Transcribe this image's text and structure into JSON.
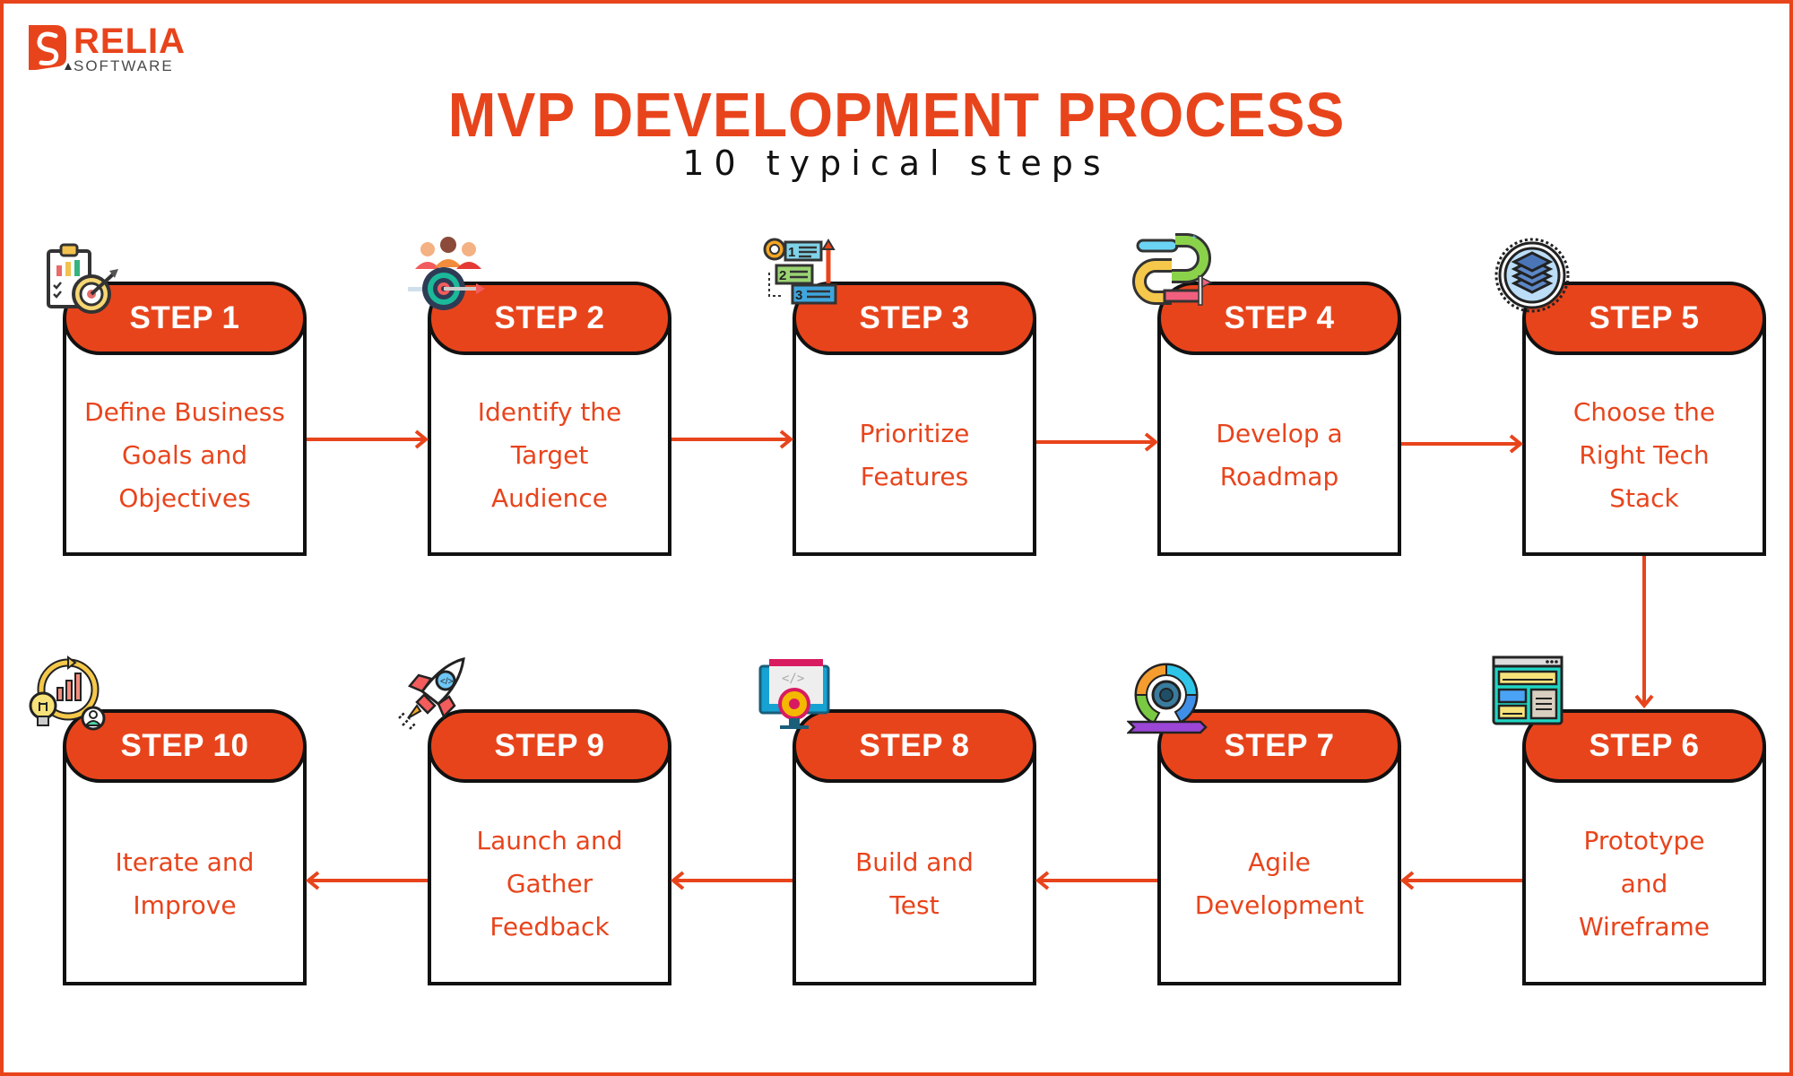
{
  "brand": {
    "name": "RELIA",
    "tagline": "SOFTWARE",
    "accent_color": "#E8441C",
    "border_color": "#111111"
  },
  "header": {
    "title": "MVP DEVELOPMENT PROCESS",
    "subtitle": "10 typical steps"
  },
  "steps": [
    {
      "label": "STEP 1",
      "text": "Define Business Goals and Objectives",
      "lines": [
        "Define Business",
        "Goals and",
        "Objectives"
      ],
      "icon": "clipboard-target-icon"
    },
    {
      "label": "STEP 2",
      "text": "Identify the Target Audience",
      "lines": [
        "Identify the",
        "Target",
        "Audience"
      ],
      "icon": "audience-target-icon"
    },
    {
      "label": "STEP 3",
      "text": "Prioritize Features",
      "lines": [
        "Prioritize",
        "Features"
      ],
      "icon": "priority-list-icon"
    },
    {
      "label": "STEP 4",
      "text": "Develop a Roadmap",
      "lines": [
        "Develop a",
        "Roadmap"
      ],
      "icon": "roadmap-path-icon"
    },
    {
      "label": "STEP 5",
      "text": "Choose the Right Tech Stack",
      "lines": [
        "Choose the",
        "Right Tech",
        "Stack"
      ],
      "icon": "layers-stack-icon"
    },
    {
      "label": "STEP 6",
      "text": "Prototype and Wireframe",
      "lines": [
        "Prototype",
        "and",
        "Wireframe"
      ],
      "icon": "wireframe-window-icon"
    },
    {
      "label": "STEP 7",
      "text": "Agile Development",
      "lines": [
        "Agile",
        "Development"
      ],
      "icon": "agile-cycle-gear-icon"
    },
    {
      "label": "STEP 8",
      "text": "Build and Test",
      "lines": [
        "Build and",
        "Test"
      ],
      "icon": "code-monitor-gear-icon"
    },
    {
      "label": "STEP 9",
      "text": "Launch and Gather Feedback",
      "lines": [
        "Launch and",
        "Gather",
        "Feedback"
      ],
      "icon": "rocket-launch-icon"
    },
    {
      "label": "STEP 10",
      "text": "Iterate and Improve",
      "lines": [
        "Iterate and",
        "Improve"
      ],
      "icon": "iterate-improve-icon"
    }
  ],
  "flow": [
    {
      "from": 1,
      "to": 2,
      "direction": "right"
    },
    {
      "from": 2,
      "to": 3,
      "direction": "right"
    },
    {
      "from": 3,
      "to": 4,
      "direction": "right"
    },
    {
      "from": 4,
      "to": 5,
      "direction": "right"
    },
    {
      "from": 5,
      "to": 6,
      "direction": "down"
    },
    {
      "from": 6,
      "to": 7,
      "direction": "left"
    },
    {
      "from": 7,
      "to": 8,
      "direction": "left"
    },
    {
      "from": 8,
      "to": 9,
      "direction": "left"
    },
    {
      "from": 9,
      "to": 10,
      "direction": "left"
    }
  ]
}
